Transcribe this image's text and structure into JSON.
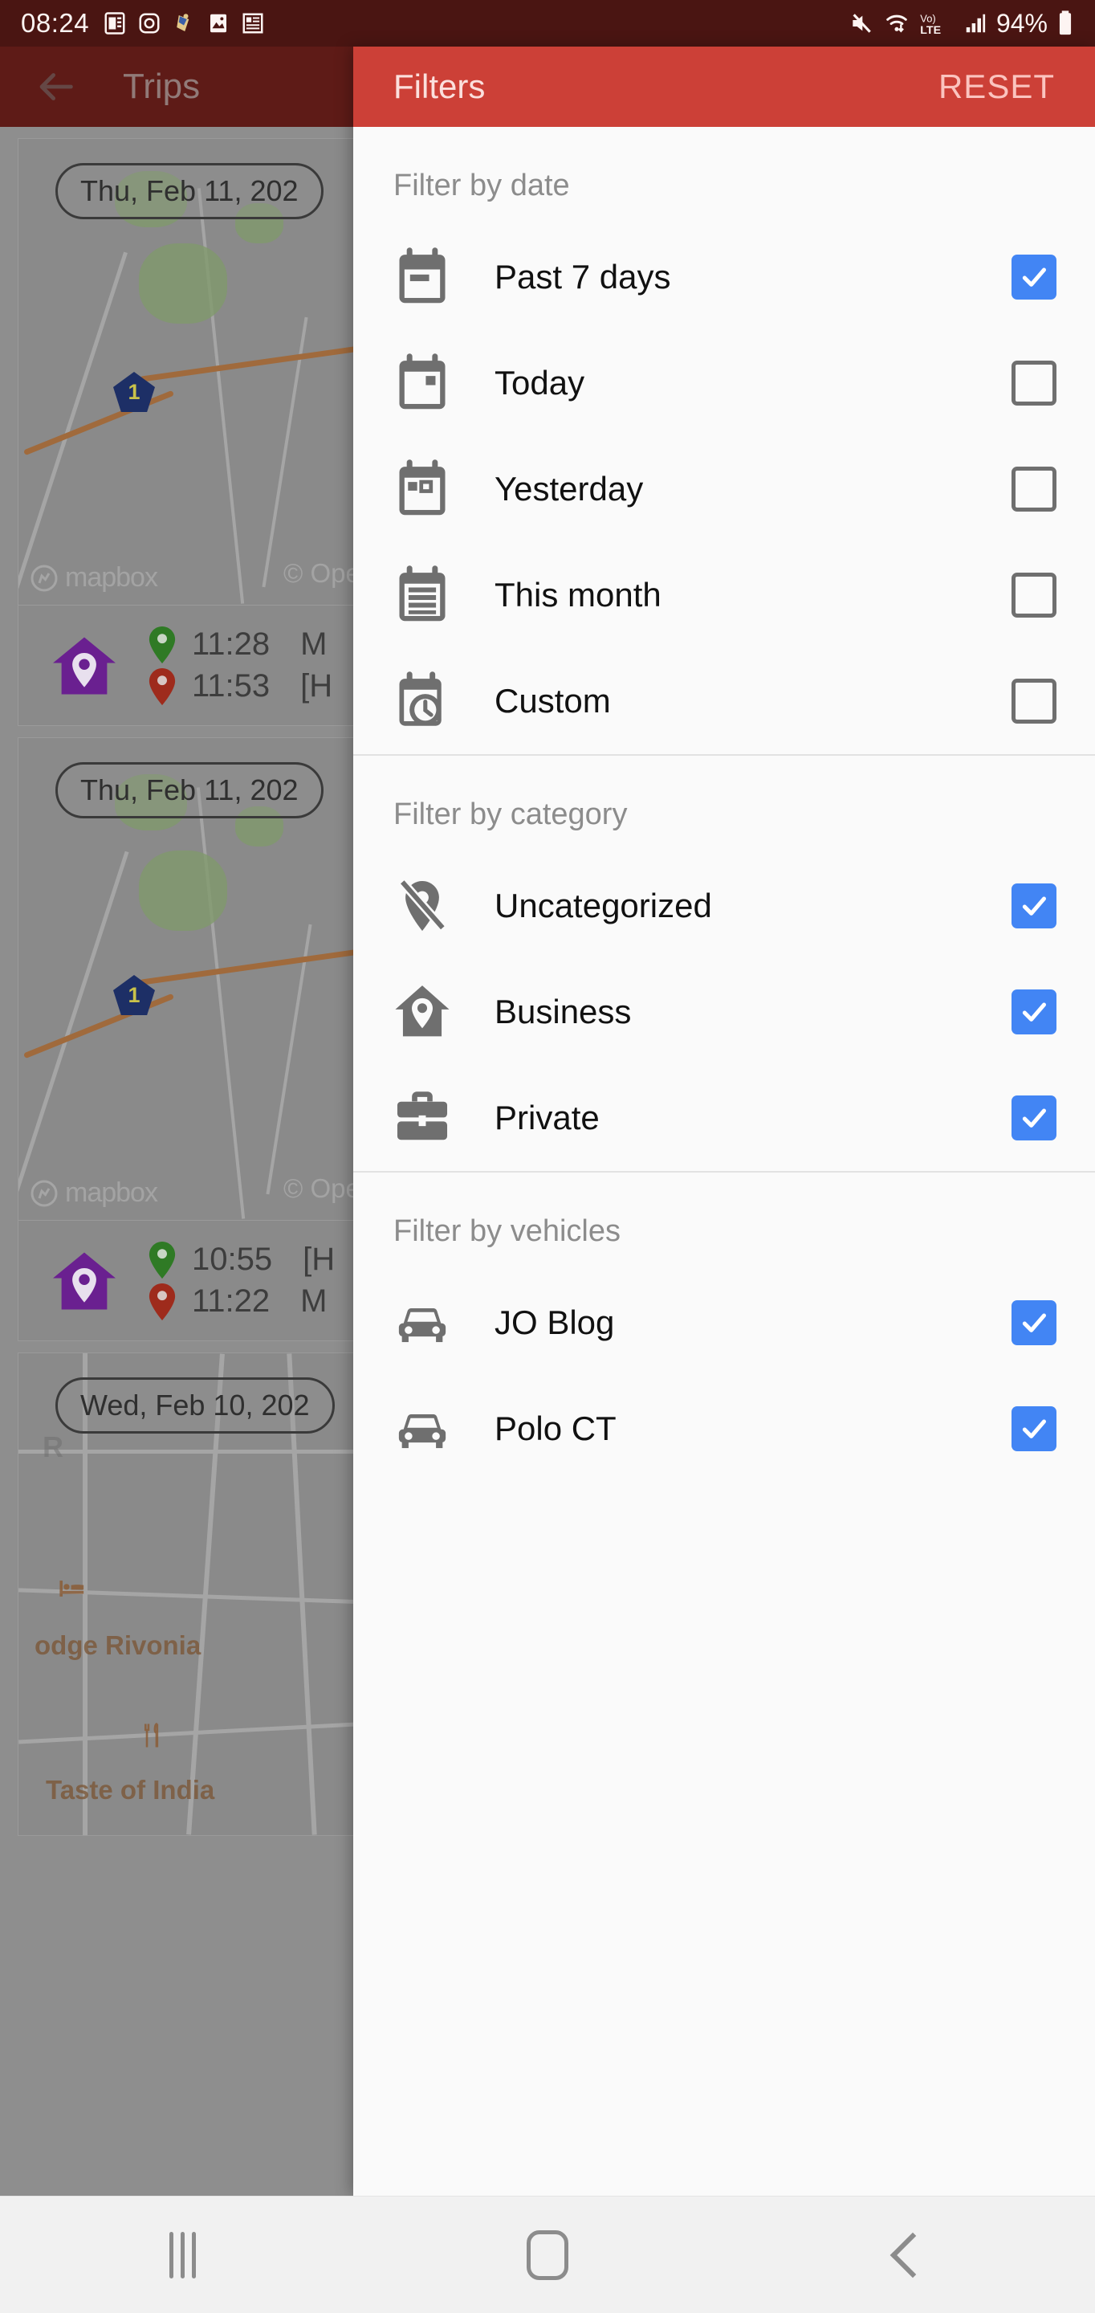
{
  "statusbar": {
    "time": "08:24",
    "battery_text": "94%",
    "left_icons": [
      "news-icon",
      "instagram-icon",
      "sticker-icon",
      "gallery-icon",
      "newspaper-icon"
    ],
    "right_icons": [
      "mute-icon",
      "wifi-icon",
      "volte-icon",
      "signal-icon",
      "battery-icon"
    ]
  },
  "app": {
    "title": "Trips",
    "back_icon": "back-arrow-icon",
    "trips": [
      {
        "date_chip": "Thu, Feb 11, 202",
        "category_icon": "home-pin-icon",
        "start_time": "11:28",
        "start_place": "M",
        "end_time": "11:53",
        "end_place": "[H",
        "map_shield": "1",
        "map_attribution": "mapbox",
        "map_attribution2": "© Ope"
      },
      {
        "date_chip": "Thu, Feb 11, 202",
        "category_icon": "home-pin-icon",
        "start_time": "10:55",
        "start_place": "[H",
        "end_time": "11:22",
        "end_place": "M",
        "map_shield": "1",
        "map_attribution": "mapbox",
        "map_attribution2": "© Ope"
      },
      {
        "date_chip": "Wed, Feb 10, 202",
        "poi_1": "odge Rivonia",
        "poi_2": "Taste of India",
        "poi_partial": "R"
      }
    ]
  },
  "panel": {
    "title": "Filters",
    "reset_label": "RESET",
    "sections": [
      {
        "title": "Filter by date",
        "items": [
          {
            "label": "Past 7 days",
            "icon": "calendar-week-icon",
            "checked": true
          },
          {
            "label": "Today",
            "icon": "calendar-today-icon",
            "checked": false
          },
          {
            "label": "Yesterday",
            "icon": "calendar-yesterday-icon",
            "checked": false
          },
          {
            "label": "This month",
            "icon": "calendar-month-icon",
            "checked": false
          },
          {
            "label": "Custom",
            "icon": "calendar-clock-icon",
            "checked": false
          }
        ]
      },
      {
        "title": "Filter by category",
        "items": [
          {
            "label": "Uncategorized",
            "icon": "pin-off-icon",
            "checked": true
          },
          {
            "label": "Business",
            "icon": "home-pin-icon",
            "checked": true
          },
          {
            "label": "Private",
            "icon": "briefcase-icon",
            "checked": true
          }
        ]
      },
      {
        "title": "Filter by vehicles",
        "items": [
          {
            "label": "JO Blog",
            "icon": "car-icon",
            "checked": true
          },
          {
            "label": "Polo CT",
            "icon": "car-icon",
            "checked": true
          }
        ]
      }
    ]
  },
  "navbar": {
    "recents_label": "recents-icon",
    "home_label": "home-icon",
    "back_label": "back-icon"
  },
  "colors": {
    "accent_red": "#cc4037",
    "status_bar": "#4a1512",
    "checkbox_blue": "#4285f4",
    "category_purple": "#6a2090"
  }
}
